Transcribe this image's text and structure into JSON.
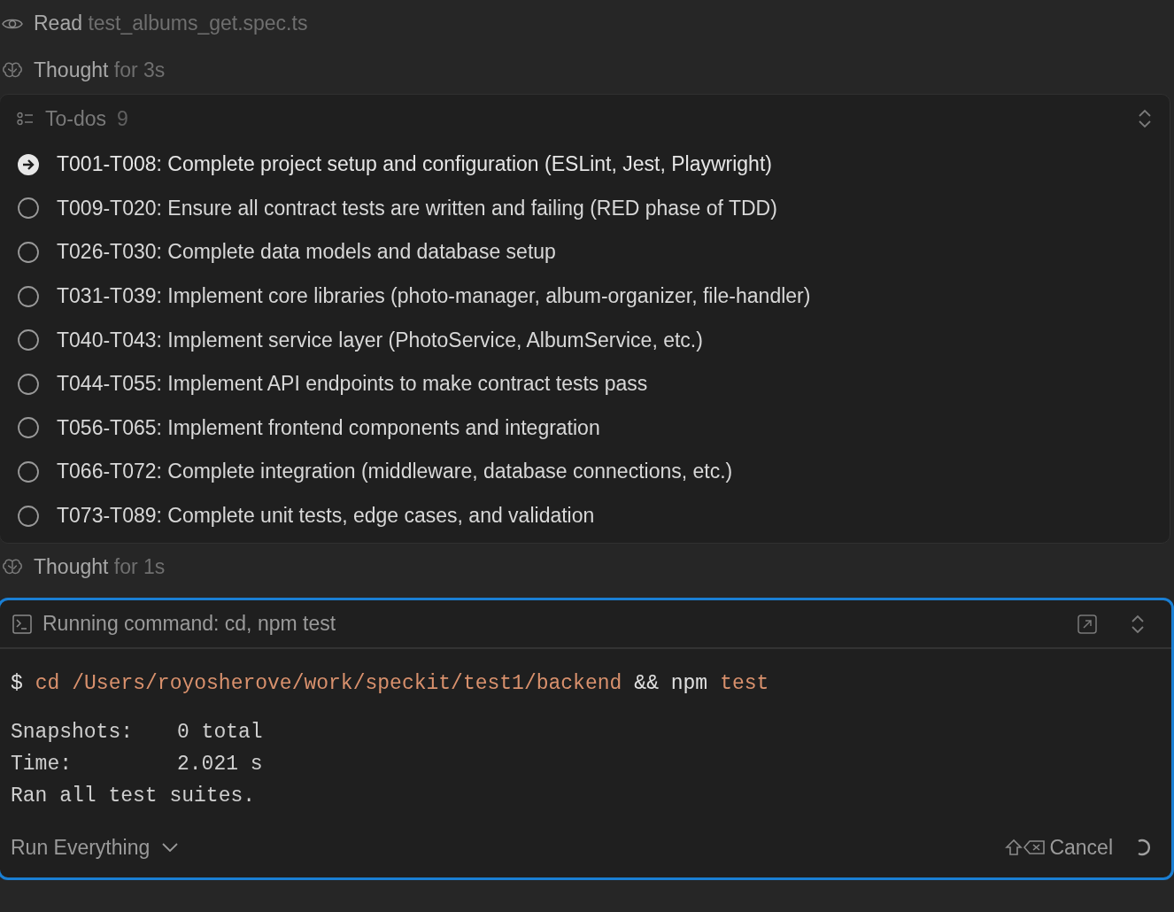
{
  "activity": [
    {
      "kind": "read",
      "verb": "Read",
      "detail": "test_albums_get.spec.ts"
    },
    {
      "kind": "thought",
      "verb": "Thought",
      "detail": "for 3s"
    }
  ],
  "todos": {
    "title": "To-dos",
    "count": "9",
    "items": [
      {
        "kind": "current",
        "text": "T001-T008: Complete project setup and configuration (ESLint, Jest, Playwright)"
      },
      {
        "kind": "pending",
        "text": "T009-T020: Ensure all contract tests are written and failing (RED phase of TDD)"
      },
      {
        "kind": "pending",
        "text": "T026-T030: Complete data models and database setup"
      },
      {
        "kind": "pending",
        "text": "T031-T039: Implement core libraries (photo-manager, album-organizer, file-handler)"
      },
      {
        "kind": "pending",
        "text": "T040-T043: Implement service layer (PhotoService, AlbumService, etc.)"
      },
      {
        "kind": "pending",
        "text": "T044-T055: Implement API endpoints to make contract tests pass"
      },
      {
        "kind": "pending",
        "text": "T056-T065: Implement frontend components and integration"
      },
      {
        "kind": "pending",
        "text": "T066-T072: Complete integration (middleware, database connections, etc.)"
      },
      {
        "kind": "pending",
        "text": "T073-T089: Complete unit tests, edge cases, and validation"
      }
    ]
  },
  "thought_after": {
    "kind": "thought",
    "verb": "Thought",
    "detail": "for 1s"
  },
  "terminal": {
    "title": "Running command: cd, npm test",
    "focused": true,
    "command": [
      {
        "kind": "prompt",
        "text": "$"
      },
      {
        "kind": "arg",
        "text": "cd /Users/royosherove/work/speckit/test1/backend"
      },
      {
        "kind": "plain",
        "text": "&& npm"
      },
      {
        "kind": "arg",
        "text": "test"
      }
    ],
    "output": [
      {
        "label": "Snapshots:",
        "value": "0 total"
      },
      {
        "label": "Time:",
        "value": "2.021 s"
      },
      {
        "label": "Ran all test suites."
      }
    ],
    "mode": "Run Everything",
    "cancel": "Cancel"
  }
}
